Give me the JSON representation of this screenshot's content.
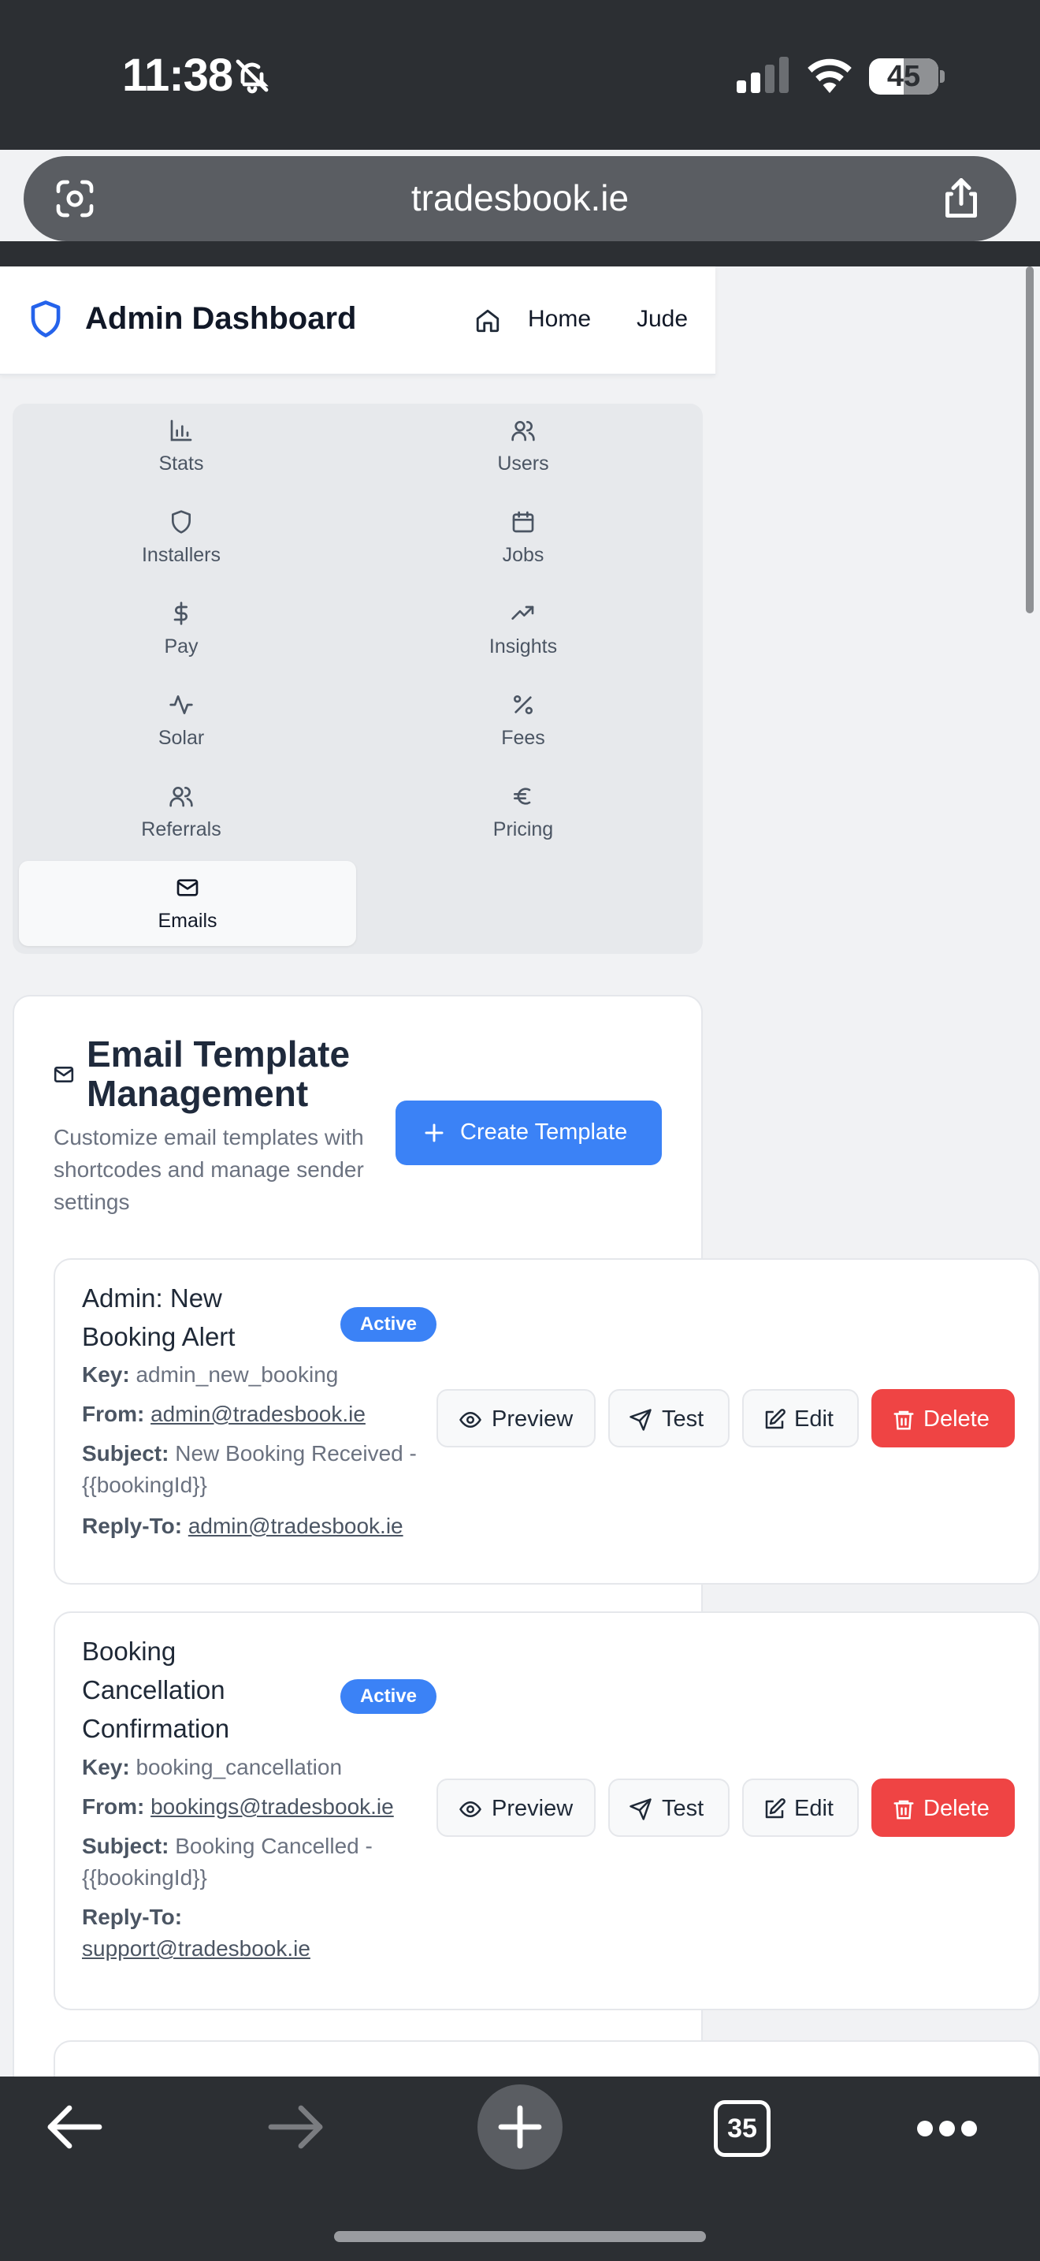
{
  "status_bar": {
    "time": "11:38",
    "battery": "45"
  },
  "browser": {
    "url": "tradesbook.ie",
    "tabs_count": "35"
  },
  "header": {
    "title": "Admin Dashboard",
    "home_label": "Home",
    "user_label": "Jude"
  },
  "nav": {
    "items": [
      {
        "label": "Stats",
        "icon": "bar-chart-icon"
      },
      {
        "label": "Users",
        "icon": "users-icon"
      },
      {
        "label": "Installers",
        "icon": "shield-icon"
      },
      {
        "label": "Jobs",
        "icon": "calendar-icon"
      },
      {
        "label": "Pay",
        "icon": "dollar-icon"
      },
      {
        "label": "Insights",
        "icon": "trending-up-icon"
      },
      {
        "label": "Solar",
        "icon": "activity-icon"
      },
      {
        "label": "Fees",
        "icon": "percent-icon"
      },
      {
        "label": "Referrals",
        "icon": "users-icon"
      },
      {
        "label": "Pricing",
        "icon": "euro-icon"
      },
      {
        "label": "Emails",
        "icon": "mail-icon",
        "active": true
      }
    ]
  },
  "email_section": {
    "title": "Email Template Management",
    "description": "Customize email templates with shortcodes and manage sender settings",
    "create_label": "Create Template"
  },
  "labels": {
    "key": "Key:",
    "from": "From:",
    "subject": "Subject:",
    "reply_to": "Reply-To:",
    "preview": "Preview",
    "test": "Test",
    "edit": "Edit",
    "delete": "Delete"
  },
  "templates": [
    {
      "name": "Admin: New Booking Alert",
      "status": "Active",
      "key": "admin_new_booking",
      "from": "admin@tradesbook.ie",
      "subject": "New Booking Received - {{bookingId}}",
      "reply_to": "admin@tradesbook.ie"
    },
    {
      "name": "Booking Cancellation Confirmation",
      "status": "Active",
      "key": "booking_cancellation",
      "from": "bookings@tradesbook.ie",
      "subject": "Booking Cancelled - {{bookingId}}",
      "reply_to": "support@tradesbook.ie"
    }
  ],
  "colors": {
    "primary": "#3b82f6",
    "danger": "#ef4444",
    "chrome": "#2c2f33"
  }
}
